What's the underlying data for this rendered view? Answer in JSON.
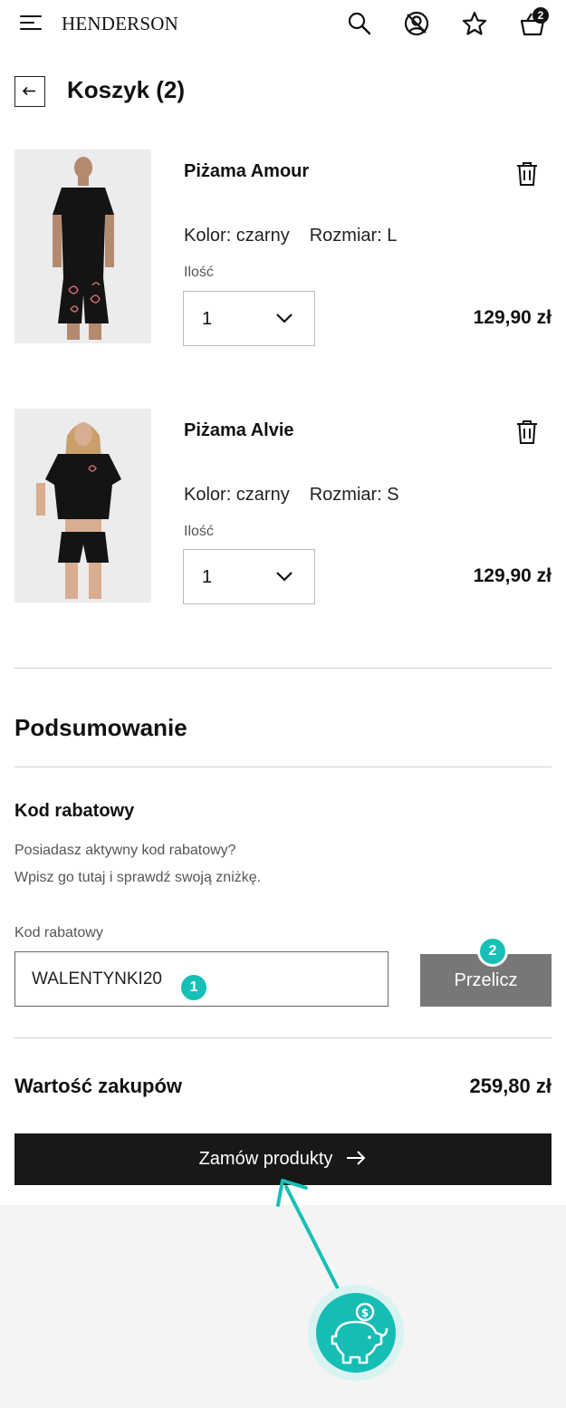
{
  "header": {
    "logo": "HENDERSON",
    "cart_count": "2",
    "icons": [
      "menu-icon",
      "search-icon",
      "account-icon",
      "star-icon",
      "basket-icon"
    ]
  },
  "cart": {
    "title": "Koszyk (2)",
    "items": [
      {
        "name": "Piżama Amour",
        "color": "Kolor: czarny",
        "size": "Rozmiar: L",
        "qty_label": "Ilość",
        "qty": "1",
        "price": "129,90 zł"
      },
      {
        "name": "Piżama Alvie",
        "color": "Kolor: czarny",
        "size": "Rozmiar: S",
        "qty_label": "Ilość",
        "qty": "1",
        "price": "129,90 zł"
      }
    ]
  },
  "summary": {
    "title": "Podsumowanie",
    "discount_heading": "Kod rabatowy",
    "discount_text_1": "Posiadasz aktywny kod rabatowy?",
    "discount_text_2": "Wpisz go tutaj i sprawdź swoją zniżkę.",
    "code_label": "Kod rabatowy",
    "code_value": "WALENTYNKI20",
    "recalc_label": "Przelicz",
    "total_label": "Wartość zakupów",
    "total_value": "259,80 zł",
    "order_label": "Zamów produkty"
  },
  "annotations": {
    "marker_1": "1",
    "marker_2": "2"
  },
  "colors": {
    "accent": "#17bfb6",
    "primary_button": "#181818",
    "secondary_button": "#777777"
  }
}
